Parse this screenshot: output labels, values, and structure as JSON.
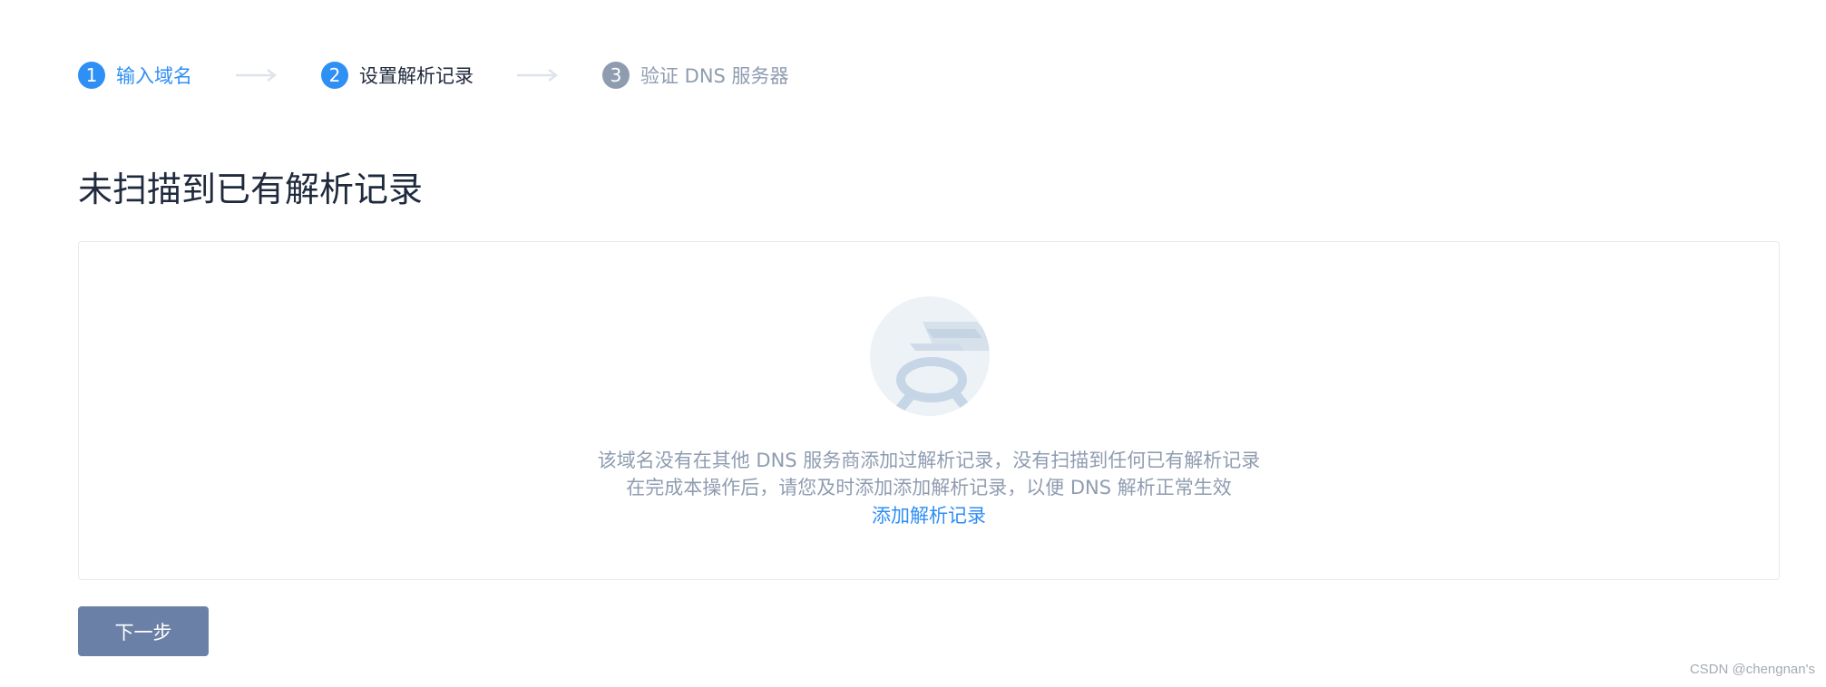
{
  "steps": [
    {
      "number": "1",
      "label": "输入域名",
      "state": "done"
    },
    {
      "number": "2",
      "label": "设置解析记录",
      "state": "active"
    },
    {
      "number": "3",
      "label": "验证 DNS 服务器",
      "state": "todo"
    }
  ],
  "main": {
    "title": "未扫描到已有解析记录",
    "empty": {
      "icon": "magnifier-document-icon",
      "line1": "该域名没有在其他 DNS 服务商添加过解析记录，没有扫描到任何已有解析记录",
      "line2": "在完成本操作后，请您及时添加添加解析记录，以便 DNS 解析正常生效",
      "link_label": "添加解析记录"
    },
    "next_button": "下一步"
  },
  "watermark": "CSDN @chengnan's",
  "colors": {
    "primary": "#2e8ff5",
    "muted": "#8f9cb0",
    "text": "#1f2a3d",
    "button": "#6a80a6",
    "border": "#e6e9ee"
  }
}
